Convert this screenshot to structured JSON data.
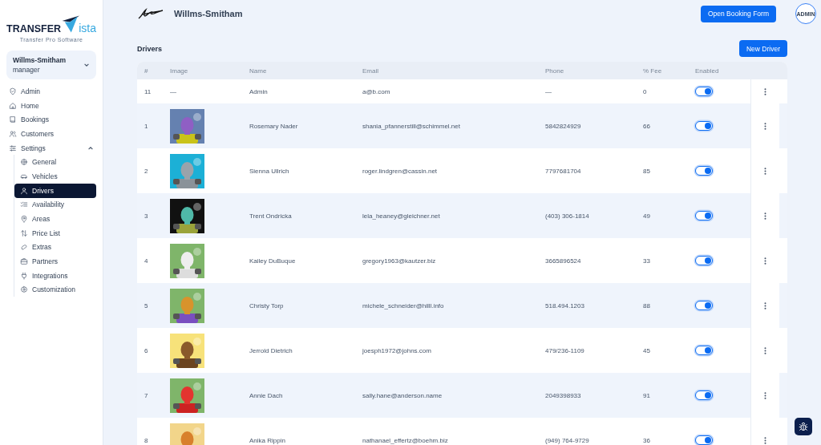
{
  "sidebar": {
    "brand": {
      "word": "TRANSFER",
      "suffix": "ista",
      "tagline": "Transfer Pro Software"
    },
    "account": {
      "name": "Willms-Smitham",
      "role": "manager"
    },
    "nav": [
      {
        "label": "Admin",
        "selected": false
      },
      {
        "label": "Home",
        "selected": false
      },
      {
        "label": "Bookings",
        "selected": false
      },
      {
        "label": "Customers",
        "selected": false
      },
      {
        "label": "Settings",
        "selected": false,
        "expanded": true,
        "children": [
          {
            "label": "General",
            "selected": false
          },
          {
            "label": "Vehicles",
            "selected": false
          },
          {
            "label": "Drivers",
            "selected": true
          },
          {
            "label": "Availability",
            "selected": false
          },
          {
            "label": "Areas",
            "selected": false
          },
          {
            "label": "Price List",
            "selected": false
          },
          {
            "label": "Extras",
            "selected": false
          },
          {
            "label": "Partners",
            "selected": false
          },
          {
            "label": "Integrations",
            "selected": false
          },
          {
            "label": "Customization",
            "selected": false
          }
        ]
      }
    ]
  },
  "topbar": {
    "company": "Willms-Smitham",
    "booking_button": "Open Booking Form",
    "avatar": "ADMIN"
  },
  "section": {
    "title": "Drivers",
    "new_button": "New Driver"
  },
  "table": {
    "columns": [
      "#",
      "Image",
      "Name",
      "Email",
      "Phone",
      "% Fee",
      "Enabled"
    ],
    "rows": [
      {
        "id": "11",
        "image": {
          "kind": "text",
          "text": "—"
        },
        "name": "Admin",
        "email": "a@b.com",
        "phone": "—",
        "fee": "0",
        "enabled": true
      },
      {
        "id": "1",
        "name": "Rosemary Nader",
        "email": "shania_pfannerstill@schimmel.net",
        "phone": "5842824929",
        "fee": "66",
        "enabled": true
      },
      {
        "id": "2",
        "name": "Sienna Ullrich",
        "email": "roger.lindgren@cassin.net",
        "phone": "7797681704",
        "fee": "85",
        "enabled": true
      },
      {
        "id": "3",
        "name": "Trent Ondricka",
        "email": "lela_heaney@gleichner.net",
        "phone": "(403) 306-1814",
        "fee": "49",
        "enabled": true
      },
      {
        "id": "4",
        "name": "Kailey DuBuque",
        "email": "gregory1963@kautzer.biz",
        "phone": "3665896524",
        "fee": "33",
        "enabled": true
      },
      {
        "id": "5",
        "name": "Christy Torp",
        "email": "michele_schneider@hilll.info",
        "phone": "518.494.1203",
        "fee": "88",
        "enabled": true
      },
      {
        "id": "6",
        "name": "Jerrold Dietrich",
        "email": "joesph1972@johns.com",
        "phone": "479/236-1109",
        "fee": "45",
        "enabled": true
      },
      {
        "id": "7",
        "name": "Annie Dach",
        "email": "sally.hane@anderson.name",
        "phone": "2049398933",
        "fee": "91",
        "enabled": true
      },
      {
        "id": "8",
        "name": "Anika Rippin",
        "email": "nathanael_effertz@boehm.biz",
        "phone": "(949) 764-9729",
        "fee": "36",
        "enabled": true
      }
    ]
  }
}
